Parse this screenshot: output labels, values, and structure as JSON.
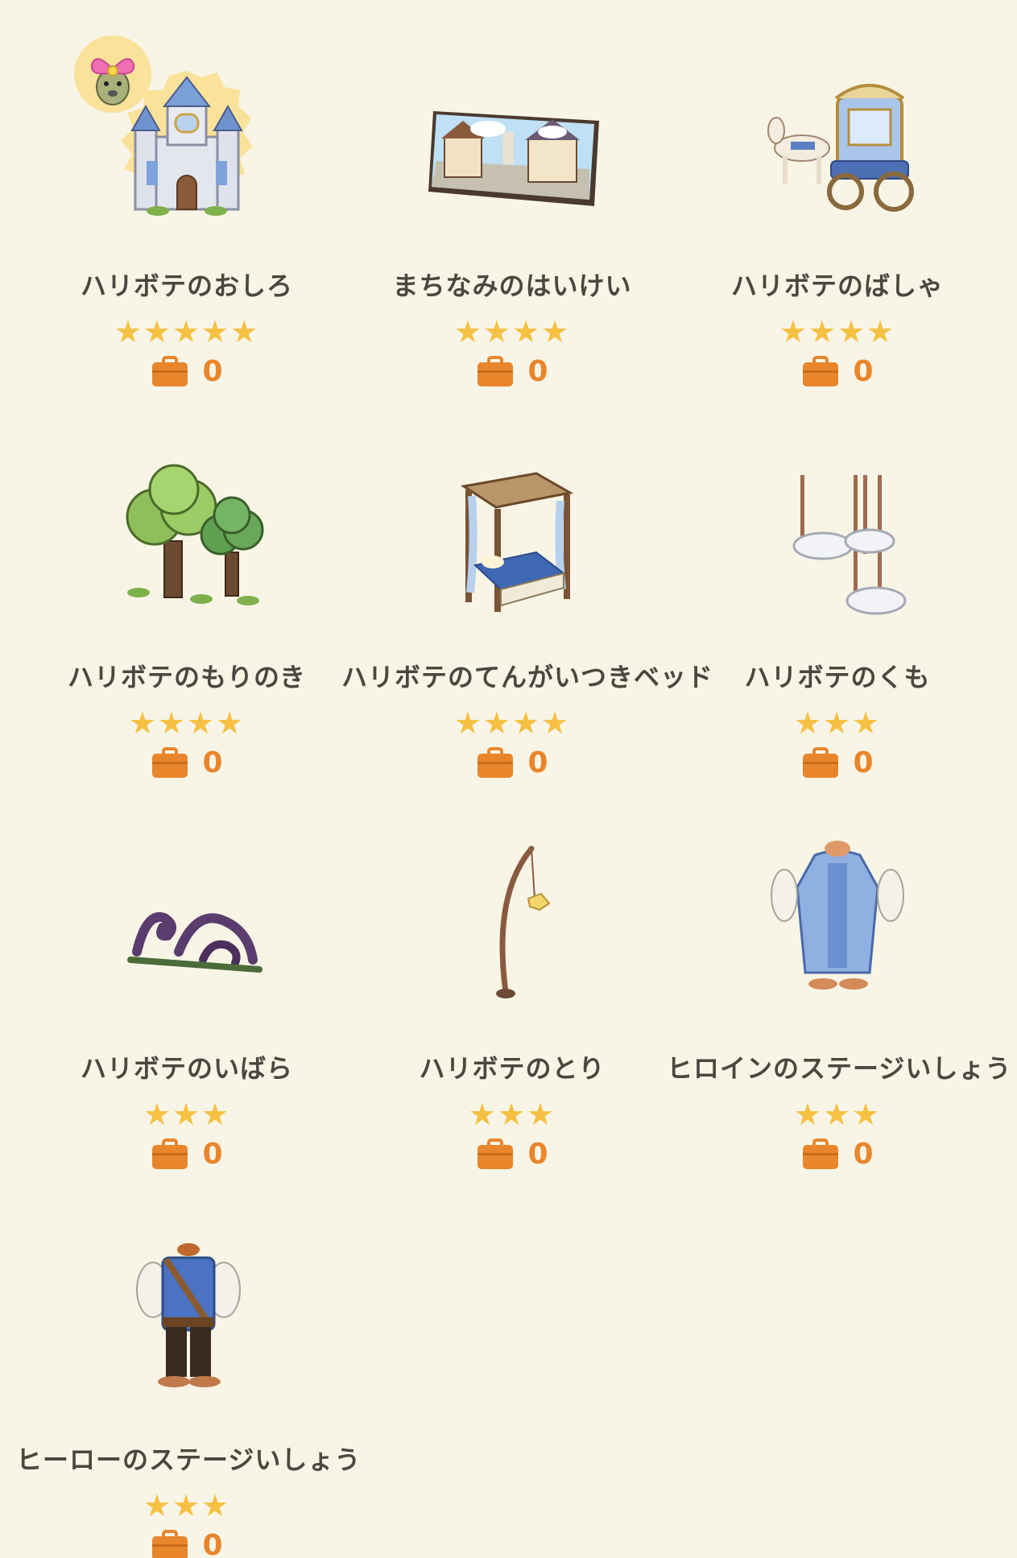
{
  "colors": {
    "background": "#f8f5e6",
    "star": "#f6c143",
    "count_orange": "#e9862c",
    "name_text": "#4d4640"
  },
  "items": [
    {
      "name": "ハリボテのおしろ",
      "stars": "★★★★★",
      "rating": 5,
      "count": "0",
      "icon": "castle-icon",
      "featured": true,
      "badge_icon": "mouse-villager-with-pink-bow-icon"
    },
    {
      "name": "まちなみのはいけい",
      "stars": "★★★★",
      "rating": 4,
      "count": "0",
      "icon": "town-backdrop-icon"
    },
    {
      "name": "ハリボテのばしゃ",
      "stars": "★★★★",
      "rating": 4,
      "count": "0",
      "icon": "carriage-icon"
    },
    {
      "name": "ハリボテのもりのき",
      "stars": "★★★★",
      "rating": 4,
      "count": "0",
      "icon": "forest-trees-icon"
    },
    {
      "name": "ハリボテのてんがいつきベッド",
      "stars": "★★★★",
      "rating": 4,
      "count": "0",
      "icon": "canopy-bed-icon"
    },
    {
      "name": "ハリボテのくも",
      "stars": "★★★",
      "rating": 3,
      "count": "0",
      "icon": "hanging-clouds-icon"
    },
    {
      "name": "ハリボテのいばら",
      "stars": "★★★",
      "rating": 3,
      "count": "0",
      "icon": "thorns-icon"
    },
    {
      "name": "ハリボテのとり",
      "stars": "★★★",
      "rating": 3,
      "count": "0",
      "icon": "bird-on-pole-icon"
    },
    {
      "name": "ヒロインのステージいしょう",
      "stars": "★★★",
      "rating": 3,
      "count": "0",
      "icon": "heroine-dress-icon"
    },
    {
      "name": "ヒーローのステージいしょう",
      "stars": "★★★",
      "rating": 3,
      "count": "0",
      "icon": "hero-outfit-icon"
    }
  ]
}
